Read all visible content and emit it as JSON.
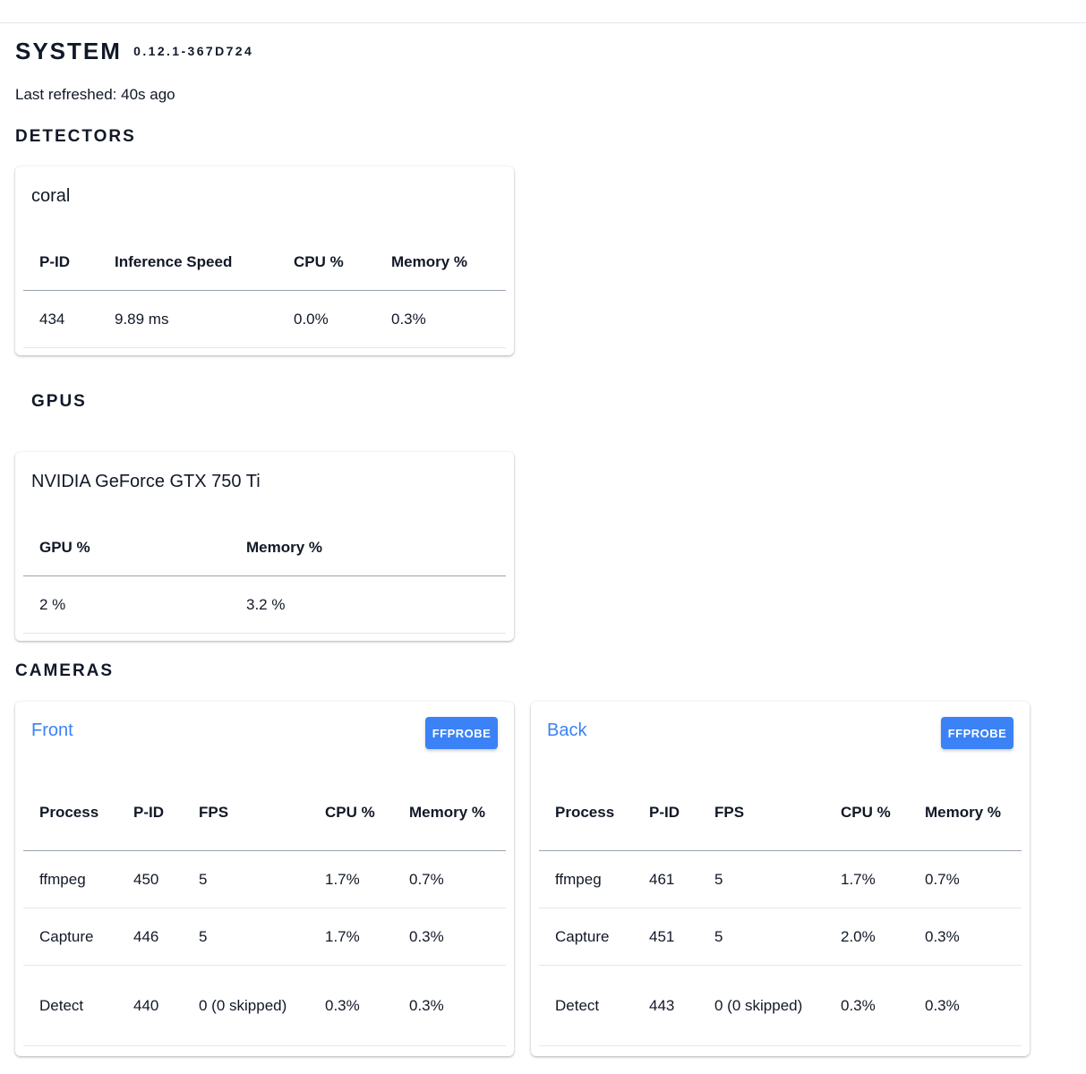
{
  "header": {
    "title": "SYSTEM",
    "version": "0.12.1-367D724",
    "last_refreshed": "Last refreshed: 40s ago"
  },
  "detectors": {
    "heading": "DETECTORS",
    "card": {
      "name": "coral",
      "columns": [
        "P-ID",
        "Inference Speed",
        "CPU %",
        "Memory %"
      ],
      "rows": [
        [
          "434",
          "9.89 ms",
          "0.0%",
          "0.3%"
        ]
      ]
    }
  },
  "gpus": {
    "heading": "GPUS",
    "card": {
      "name": "NVIDIA GeForce GTX 750 Ti",
      "columns": [
        "GPU %",
        "Memory %"
      ],
      "rows": [
        [
          "2 %",
          "3.2 %"
        ]
      ]
    }
  },
  "cameras": {
    "heading": "CAMERAS",
    "ffprobe_label": "FFPROBE",
    "columns": [
      "Process",
      "P-ID",
      "FPS",
      "CPU %",
      "Memory %"
    ],
    "list": [
      {
        "name": "Front",
        "rows": [
          [
            "ffmpeg",
            "450",
            "5",
            "1.7%",
            "0.7%"
          ],
          [
            "Capture",
            "446",
            "5",
            "1.7%",
            "0.3%"
          ],
          [
            "Detect",
            "440",
            "0 (0 skipped)",
            "0.3%",
            "0.3%"
          ]
        ]
      },
      {
        "name": "Back",
        "rows": [
          [
            "ffmpeg",
            "461",
            "5",
            "1.7%",
            "0.7%"
          ],
          [
            "Capture",
            "451",
            "5",
            "2.0%",
            "0.3%"
          ],
          [
            "Detect",
            "443",
            "0 (0 skipped)",
            "0.3%",
            "0.3%"
          ]
        ]
      }
    ]
  },
  "colors": {
    "accent": "#3b82f6",
    "text": "#111827"
  }
}
